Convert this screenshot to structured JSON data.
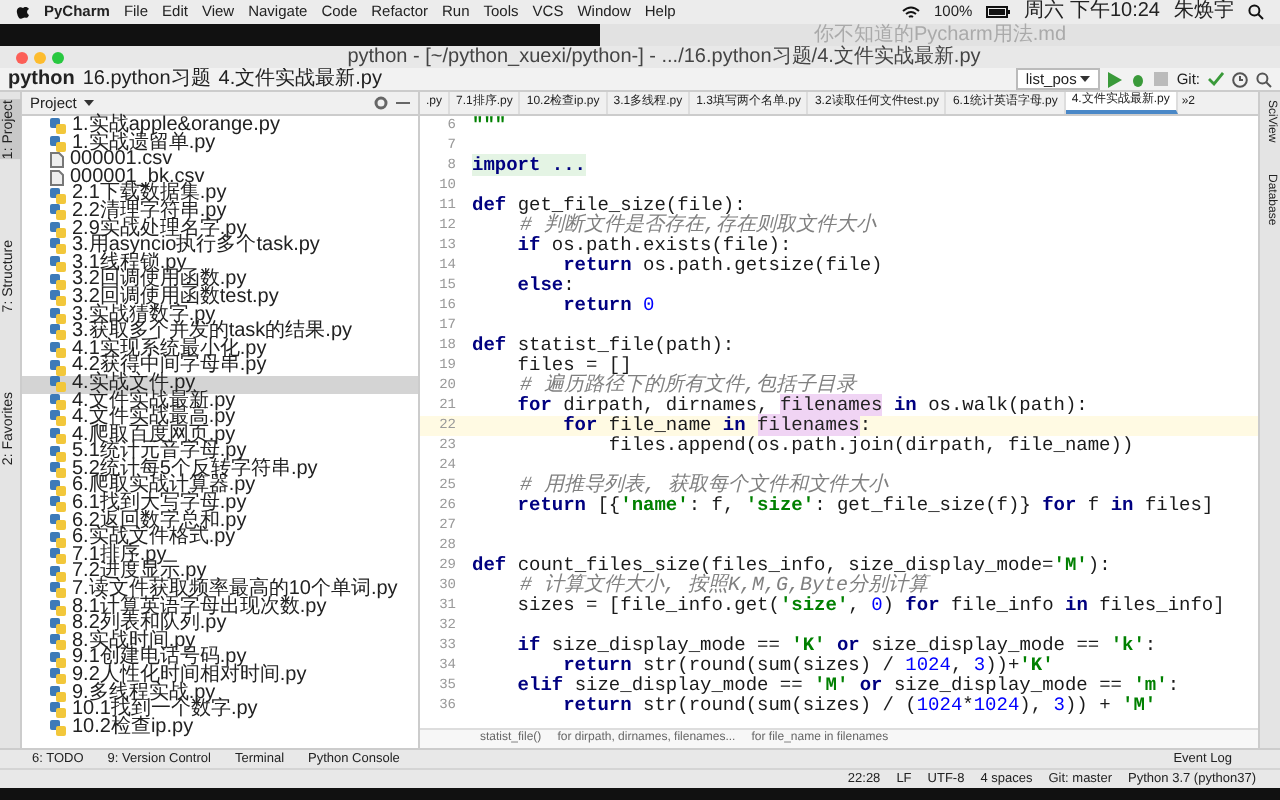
{
  "menubar": {
    "app": "PyCharm",
    "menus": [
      "File",
      "Edit",
      "View",
      "Navigate",
      "Code",
      "Refactor",
      "Run",
      "Tools",
      "VCS",
      "Window",
      "Help"
    ],
    "battery": "100%",
    "clock": "周六 下午10:24",
    "user": "朱焕宇"
  },
  "background_window": {
    "title": "你不知道的Pycharm用法.md"
  },
  "window": {
    "title": "python - [~/python_xuexi/python-] - .../16.python习题/4.文件实战最新.py"
  },
  "navbar": {
    "crumbs": [
      "python",
      "16.python习题",
      "4.文件实战最新.py"
    ],
    "run_config": "list_pos",
    "vcs_label": "Git:"
  },
  "left_strip": [
    {
      "label": "1: Project",
      "selected": true
    },
    {
      "label": "7: Structure",
      "selected": false
    },
    {
      "label": "2: Favorites",
      "selected": false
    }
  ],
  "right_strip": [
    "SciView",
    "Database"
  ],
  "project_panel": {
    "title": "Project",
    "items": [
      {
        "name": "1.实战apple&orange.py",
        "kind": "py",
        "selected": false
      },
      {
        "name": "1.实战遗留单.py",
        "kind": "py",
        "selected": false
      },
      {
        "name": "000001.csv",
        "kind": "csv",
        "selected": false
      },
      {
        "name": "000001_bk.csv",
        "kind": "csv",
        "selected": false
      },
      {
        "name": "2.1下载数据集.py",
        "kind": "py",
        "selected": false
      },
      {
        "name": "2.2清理字符串.py",
        "kind": "py",
        "selected": false
      },
      {
        "name": "2.9实战处理名字.py",
        "kind": "py",
        "selected": false
      },
      {
        "name": "3.用asyncio执行多个task.py",
        "kind": "py",
        "selected": false
      },
      {
        "name": "3.1线程锁.py",
        "kind": "py",
        "selected": false
      },
      {
        "name": "3.2回调使用函数.py",
        "kind": "py",
        "selected": false
      },
      {
        "name": "3.2回调使用函数test.py",
        "kind": "py",
        "selected": false
      },
      {
        "name": "3.实战猜数字.py",
        "kind": "py",
        "selected": false
      },
      {
        "name": "3.获取多个并发的task的结果.py",
        "kind": "py",
        "selected": false
      },
      {
        "name": "4.1实现系统最小化.py",
        "kind": "py",
        "selected": false
      },
      {
        "name": "4.2获得中间字母串.py",
        "kind": "py",
        "selected": false
      },
      {
        "name": "4.实战文件.py",
        "kind": "py",
        "selected": true
      },
      {
        "name": "4.文件实战最新.py",
        "kind": "py",
        "selected": false
      },
      {
        "name": "4.文件实战最高.py",
        "kind": "py",
        "selected": false
      },
      {
        "name": "4.爬取百度网页.py",
        "kind": "py",
        "selected": false
      },
      {
        "name": "5.1统计元音字母.py",
        "kind": "py",
        "selected": false
      },
      {
        "name": "5.2统计每5个反转字符串.py",
        "kind": "py",
        "selected": false
      },
      {
        "name": "6.爬取实战计算器.py",
        "kind": "py",
        "selected": false
      },
      {
        "name": "6.1找到大写字母.py",
        "kind": "py",
        "selected": false
      },
      {
        "name": "6.2返回数字总和.py",
        "kind": "py",
        "selected": false
      },
      {
        "name": "6.实战文件格式.py",
        "kind": "py",
        "selected": false
      },
      {
        "name": "7.1排序.py",
        "kind": "py",
        "selected": false
      },
      {
        "name": "7.2进度显示.py",
        "kind": "py",
        "selected": false
      },
      {
        "name": "7.读文件获取频率最高的10个单词.py",
        "kind": "py",
        "selected": false
      },
      {
        "name": "8.1计算英语字母出现次数.py",
        "kind": "py",
        "selected": false
      },
      {
        "name": "8.2列表和队列.py",
        "kind": "py",
        "selected": false
      },
      {
        "name": "8.实战时间.py",
        "kind": "py",
        "selected": false
      },
      {
        "name": "9.1创建电话号码.py",
        "kind": "py",
        "selected": false
      },
      {
        "name": "9.2人性化时间相对时间.py",
        "kind": "py",
        "selected": false
      },
      {
        "name": "9.多线程实战.py",
        "kind": "py",
        "selected": false
      },
      {
        "name": "10.1找到一个数字.py",
        "kind": "py",
        "selected": false
      },
      {
        "name": "10.2检查ip.py",
        "kind": "py",
        "selected": false
      }
    ]
  },
  "editor_tabs": [
    {
      "label": ".py",
      "selected": false
    },
    {
      "label": "7.1排序.py",
      "selected": false
    },
    {
      "label": "10.2检查ip.py",
      "selected": false
    },
    {
      "label": "3.1多线程.py",
      "selected": false
    },
    {
      "label": "1.3填写两个名单.py",
      "selected": false
    },
    {
      "label": "3.2读取任何文件test.py",
      "selected": false
    },
    {
      "label": "6.1统计英语字母.py",
      "selected": false
    },
    {
      "label": "4.文件实战最新.py",
      "selected": true
    }
  ],
  "tabs_overflow": "»2",
  "editor": {
    "lines": [
      {
        "number": "6",
        "current": false,
        "tokens": [
          {
            "kind": "str",
            "text": "\"\"\""
          }
        ]
      },
      {
        "number": "7",
        "current": false
      },
      {
        "number": "8",
        "current": false,
        "tokens": [
          {
            "kind": "fold",
            "text": "import ..."
          }
        ]
      },
      {
        "number": "10",
        "current": false
      },
      {
        "number": "11",
        "current": false,
        "tokens": [
          {
            "kind": "kw",
            "text": "def "
          },
          {
            "kind": "p",
            "text": "get_file_size(file):"
          }
        ]
      },
      {
        "number": "12",
        "current": false,
        "tokens": [
          {
            "kind": "cm",
            "text": "    # 判断文件是否存在,存在则取文件大小"
          }
        ]
      },
      {
        "number": "13",
        "current": false,
        "tokens": [
          {
            "kind": "kw",
            "text": "    if "
          },
          {
            "kind": "p",
            "text": "os.path.exists(file):"
          }
        ]
      },
      {
        "number": "14",
        "current": false,
        "tokens": [
          {
            "kind": "kw",
            "text": "        return "
          },
          {
            "kind": "p",
            "text": "os.path.getsize(file)"
          }
        ]
      },
      {
        "number": "15",
        "current": false,
        "tokens": [
          {
            "kind": "kw",
            "text": "    else"
          },
          {
            "kind": "p",
            "text": ":"
          }
        ]
      },
      {
        "number": "16",
        "current": false,
        "tokens": [
          {
            "kind": "kw",
            "text": "        return "
          },
          {
            "kind": "num",
            "text": "0"
          }
        ]
      },
      {
        "number": "17",
        "current": false
      },
      {
        "number": "18",
        "current": false,
        "tokens": [
          {
            "kind": "kw",
            "text": "def "
          },
          {
            "kind": "p",
            "text": "statist_file(path):"
          }
        ]
      },
      {
        "number": "19",
        "current": false,
        "tokens": [
          {
            "kind": "p",
            "text": "    files = []"
          }
        ]
      },
      {
        "number": "20",
        "current": false,
        "tokens": [
          {
            "kind": "cm",
            "text": "    # 遍历路径下的所有文件,包括子目录"
          }
        ]
      },
      {
        "number": "21",
        "current": false,
        "tokens": [
          {
            "kind": "kw",
            "text": "    for "
          },
          {
            "kind": "p",
            "text": "dirpath, dirnames, "
          },
          {
            "kind": "hl",
            "text": "filenames"
          },
          {
            "kind": "kw",
            "text": " in "
          },
          {
            "kind": "p",
            "text": "os.walk(path):"
          }
        ]
      },
      {
        "number": "22",
        "current": true,
        "tokens": [
          {
            "kind": "kw",
            "text": "        for "
          },
          {
            "kind": "p",
            "text": "file_name"
          },
          {
            "kind": "kw",
            "text": " in "
          },
          {
            "kind": "hl",
            "text": "filenames"
          },
          {
            "kind": "p",
            "text": ":"
          }
        ]
      },
      {
        "number": "23",
        "current": false,
        "tokens": [
          {
            "kind": "p",
            "text": "            files.append(os.path.join(dirpath, file_name))"
          }
        ]
      },
      {
        "number": "24",
        "current": false
      },
      {
        "number": "25",
        "current": false,
        "tokens": [
          {
            "kind": "cm",
            "text": "    # 用推导列表, 获取每个文件和文件大小"
          }
        ]
      },
      {
        "number": "26",
        "current": false,
        "tokens": [
          {
            "kind": "kw",
            "text": "    return "
          },
          {
            "kind": "p",
            "text": "[{"
          },
          {
            "kind": "str",
            "text": "'name'"
          },
          {
            "kind": "p",
            "text": ": f, "
          },
          {
            "kind": "str",
            "text": "'size'"
          },
          {
            "kind": "p",
            "text": ": get_file_size(f)} "
          },
          {
            "kind": "kw",
            "text": "for "
          },
          {
            "kind": "p",
            "text": "f "
          },
          {
            "kind": "kw",
            "text": "in "
          },
          {
            "kind": "p",
            "text": "files]"
          }
        ]
      },
      {
        "number": "27",
        "current": false
      },
      {
        "number": "28",
        "current": false
      },
      {
        "number": "29",
        "current": false,
        "tokens": [
          {
            "kind": "kw",
            "text": "def "
          },
          {
            "kind": "p",
            "text": "count_files_size(files_info, size_display_mode="
          },
          {
            "kind": "str",
            "text": "'M'"
          },
          {
            "kind": "p",
            "text": "):"
          }
        ]
      },
      {
        "number": "30",
        "current": false,
        "tokens": [
          {
            "kind": "cm",
            "text": "    # 计算文件大小, 按照K,M,G,Byte分别计算"
          }
        ]
      },
      {
        "number": "31",
        "current": false,
        "tokens": [
          {
            "kind": "p",
            "text": "    sizes = [file_info.get("
          },
          {
            "kind": "str",
            "text": "'size'"
          },
          {
            "kind": "p",
            "text": ", "
          },
          {
            "kind": "num",
            "text": "0"
          },
          {
            "kind": "p",
            "text": ") "
          },
          {
            "kind": "kw",
            "text": "for "
          },
          {
            "kind": "p",
            "text": "file_info "
          },
          {
            "kind": "kw",
            "text": "in "
          },
          {
            "kind": "p",
            "text": "files_info]"
          }
        ]
      },
      {
        "number": "32",
        "current": false
      },
      {
        "number": "33",
        "current": false,
        "tokens": [
          {
            "kind": "kw",
            "text": "    if "
          },
          {
            "kind": "p",
            "text": "size_display_mode == "
          },
          {
            "kind": "str",
            "text": "'K'"
          },
          {
            "kind": "kw",
            "text": " or "
          },
          {
            "kind": "p",
            "text": "size_display_mode == "
          },
          {
            "kind": "str",
            "text": "'k'"
          },
          {
            "kind": "p",
            "text": ":"
          }
        ]
      },
      {
        "number": "34",
        "current": false,
        "tokens": [
          {
            "kind": "kw",
            "text": "        return "
          },
          {
            "kind": "p",
            "text": "str(round(sum(sizes) / "
          },
          {
            "kind": "num",
            "text": "1024"
          },
          {
            "kind": "p",
            "text": ", "
          },
          {
            "kind": "num",
            "text": "3"
          },
          {
            "kind": "p",
            "text": "))+"
          },
          {
            "kind": "str",
            "text": "'K'"
          }
        ]
      },
      {
        "number": "35",
        "current": false,
        "tokens": [
          {
            "kind": "kw",
            "text": "    elif "
          },
          {
            "kind": "p",
            "text": "size_display_mode == "
          },
          {
            "kind": "str",
            "text": "'M'"
          },
          {
            "kind": "kw",
            "text": " or "
          },
          {
            "kind": "p",
            "text": "size_display_mode == "
          },
          {
            "kind": "str",
            "text": "'m'"
          },
          {
            "kind": "p",
            "text": ":"
          }
        ]
      },
      {
        "number": "36",
        "current": false,
        "tokens": [
          {
            "kind": "kw",
            "text": "        return "
          },
          {
            "kind": "p",
            "text": "str(round(sum(sizes) / ("
          },
          {
            "kind": "num",
            "text": "1024"
          },
          {
            "kind": "p",
            "text": "*"
          },
          {
            "kind": "num",
            "text": "1024"
          },
          {
            "kind": "p",
            "text": "), "
          },
          {
            "kind": "num",
            "text": "3"
          },
          {
            "kind": "p",
            "text": ")) + "
          },
          {
            "kind": "str",
            "text": "'M'"
          }
        ]
      }
    ],
    "breadcrumbs": [
      "statist_file()",
      "for dirpath, dirnames, filenames...",
      "for file_name in filenames"
    ]
  },
  "tool_tabs": [
    "6: TODO",
    "9: Version Control",
    "Terminal",
    "Python Console"
  ],
  "event_log": "Event Log",
  "status_bar": [
    "22:28",
    "LF",
    "UTF-8",
    "4 spaces",
    "Git: master",
    "Python 3.7 (python37)"
  ]
}
